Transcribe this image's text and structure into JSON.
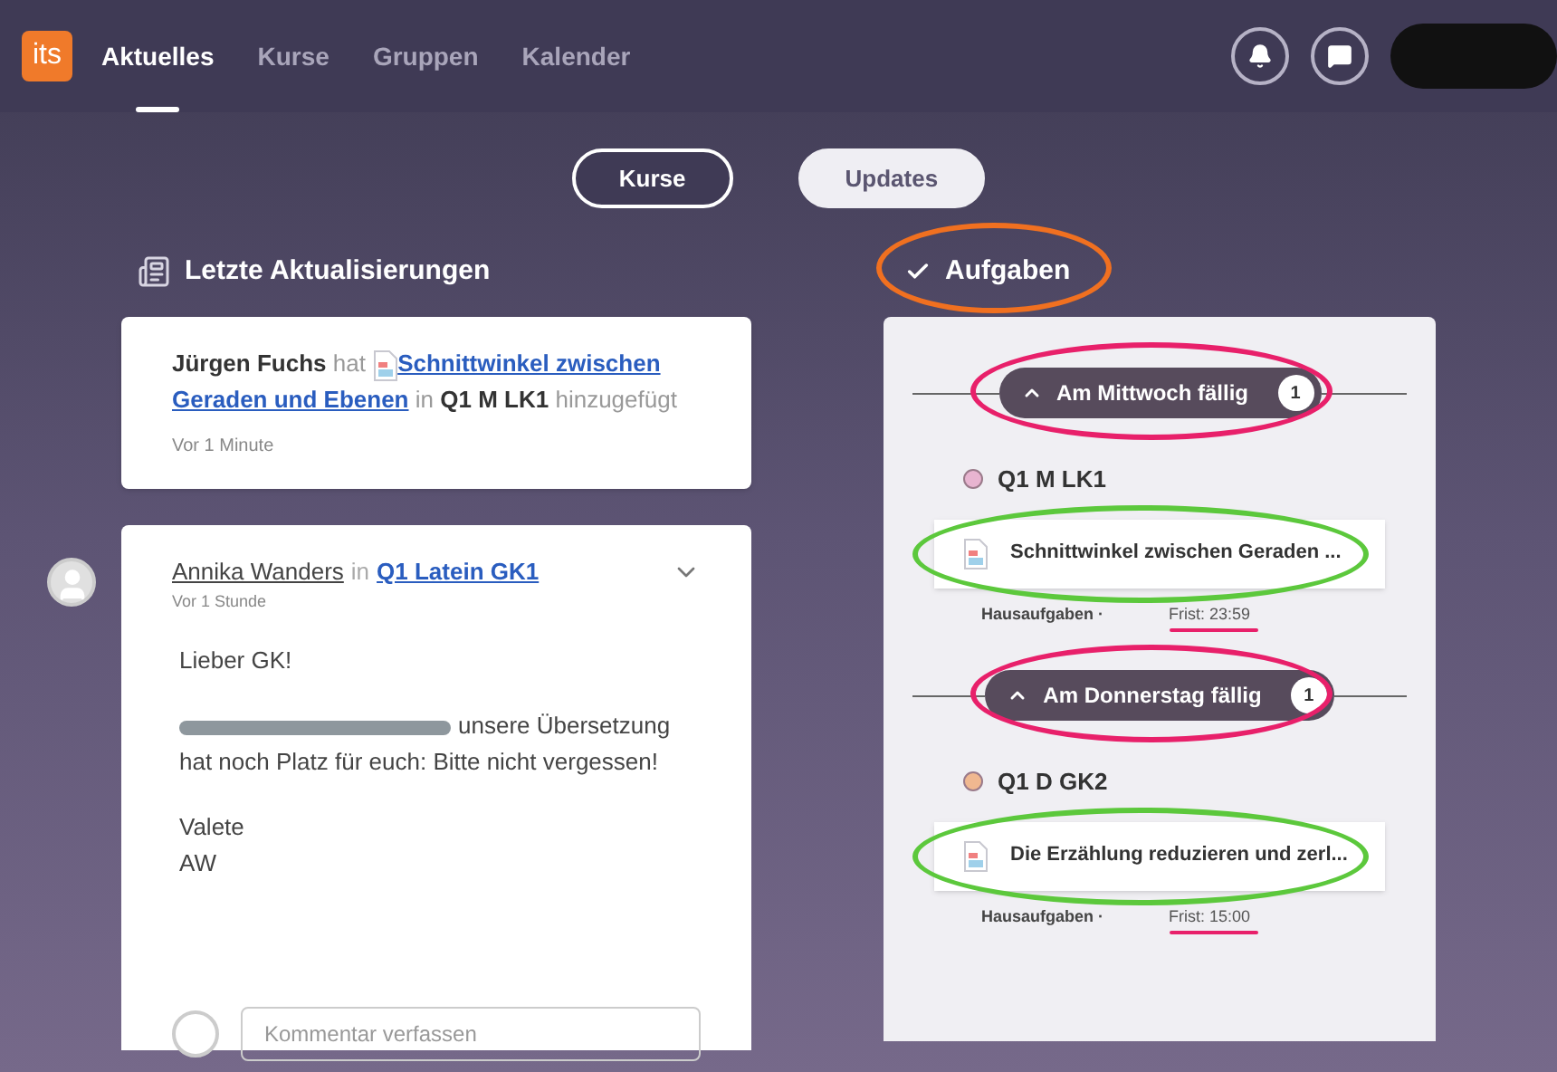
{
  "nav": {
    "logo": "its",
    "tabs": [
      {
        "label": "Aktuelles",
        "selected": true
      },
      {
        "label": "Kurse",
        "selected": false
      },
      {
        "label": "Gruppen",
        "selected": false
      },
      {
        "label": "Kalender",
        "selected": false
      }
    ]
  },
  "switcher": [
    {
      "label": "Kurse",
      "selected": false
    },
    {
      "label": "Updates",
      "selected": true
    }
  ],
  "updates": {
    "title": "Letzte Aktualisierungen",
    "entry": {
      "author": "Jürgen Fuchs",
      "verb": "hat",
      "link": [
        "Schnittwinkel zwischen",
        "Geraden und Ebenen"
      ],
      "in": "in",
      "course": "Q1 M LK1",
      "action": "hinzugefügt",
      "time": "Vor 1 Minute"
    },
    "post": {
      "author": "Annika Wanders",
      "in": "in",
      "group": "Q1 Latein GK1",
      "time": "Vor 1 Stunde",
      "greeting": "Lieber GK!",
      "body": "unsere Übersetzung hat noch Platz für euch: Bitte nicht vergessen!",
      "closing": "Valete",
      "signature": "AW",
      "comment_placeholder": "Kommentar verfassen"
    }
  },
  "tasks": {
    "title": "Aufgaben",
    "ring": {
      "color": "#f07020"
    },
    "groups": [
      {
        "label": "Am Mittwoch fällig",
        "count": "1",
        "ring": {
          "color": "#e8206a"
        },
        "course": "Q1 M LK1",
        "color": "#e8b4d0",
        "task": "Schnittwinkel zwischen Geraden ...",
        "task_ring": {
          "color": "#5cc83c"
        },
        "type": "Hausaufgaben ·",
        "due": "Frist: 23:59",
        "due_underline": {
          "color": "#e8206a"
        }
      },
      {
        "label": "Am Donnerstag fällig",
        "count": "1",
        "ring": {
          "color": "#e8206a"
        },
        "course": "Q1 D GK2",
        "color": "#f0b890",
        "task": "Die Erzählung reduzieren und zerl...",
        "task_ring": {
          "color": "#5cc83c"
        },
        "type": "Hausaufgaben ·",
        "due": "Frist: 15:00",
        "due_underline": {
          "color": "#e8206a"
        }
      }
    ]
  }
}
